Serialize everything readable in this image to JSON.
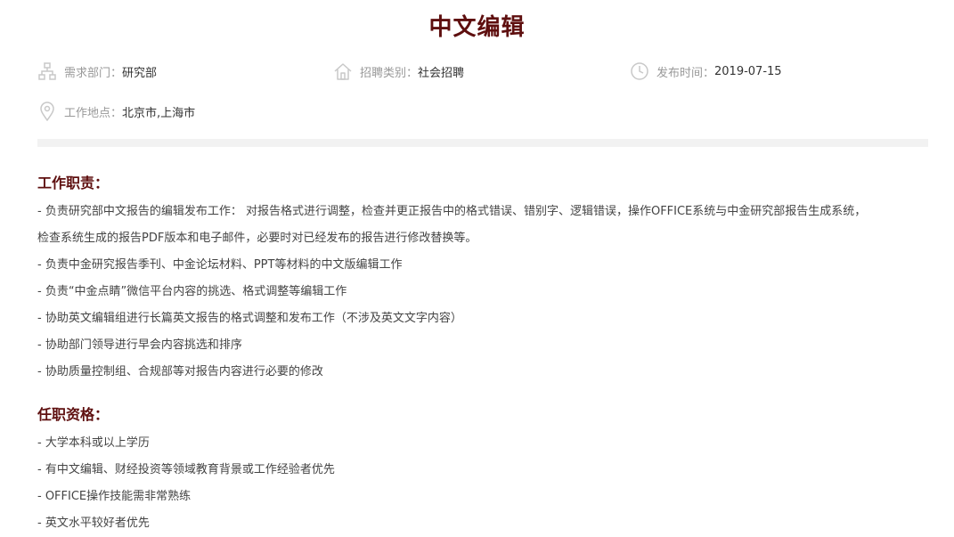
{
  "job": {
    "title": "中文编辑",
    "meta": {
      "department_label": "需求部门：",
      "department_value": "研究部",
      "category_label": "招聘类别：",
      "category_value": "社会招聘",
      "date_label": "发布时间：",
      "date_value": "2019-07-15",
      "location_label": "工作地点：",
      "location_value": "北京市,上海市"
    }
  },
  "duties": {
    "title": "工作职责：",
    "items": [
      "- 负责研究部中文报告的编辑发布工作： 对报告格式进行调整，检查并更正报告中的格式错误、错别字、逻辑错误，操作OFFICE系统与中金研究部报告生成系统，",
      "检查系统生成的报告PDF版本和电子邮件，必要时对已经发布的报告进行修改替换等。",
      "- 负责中金研究报告季刊、中金论坛材料、PPT等材料的中文版编辑工作",
      "- 负责“中金点睛”微信平台内容的挑选、格式调整等编辑工作",
      "- 协助英文编辑组进行长篇英文报告的格式调整和发布工作（不涉及英文文字内容）",
      "- 协助部门领导进行早会内容挑选和排序",
      "- 协助质量控制组、合规部等对报告内容进行必要的修改"
    ]
  },
  "requirements": {
    "title": "任职资格：",
    "items": [
      "- 大学本科或以上学历",
      "- 有中文编辑、财经投资等领域教育背景或工作经验者优先",
      "- OFFICE操作技能需非常熟练",
      "- 英文水平较好者优先"
    ]
  },
  "colors": {
    "heading": "#5e0f0f",
    "muted": "#999999",
    "icon": "#c8c8c8"
  },
  "icons": [
    "org-chart-icon",
    "house-icon",
    "clock-icon",
    "location-pin-icon"
  ]
}
